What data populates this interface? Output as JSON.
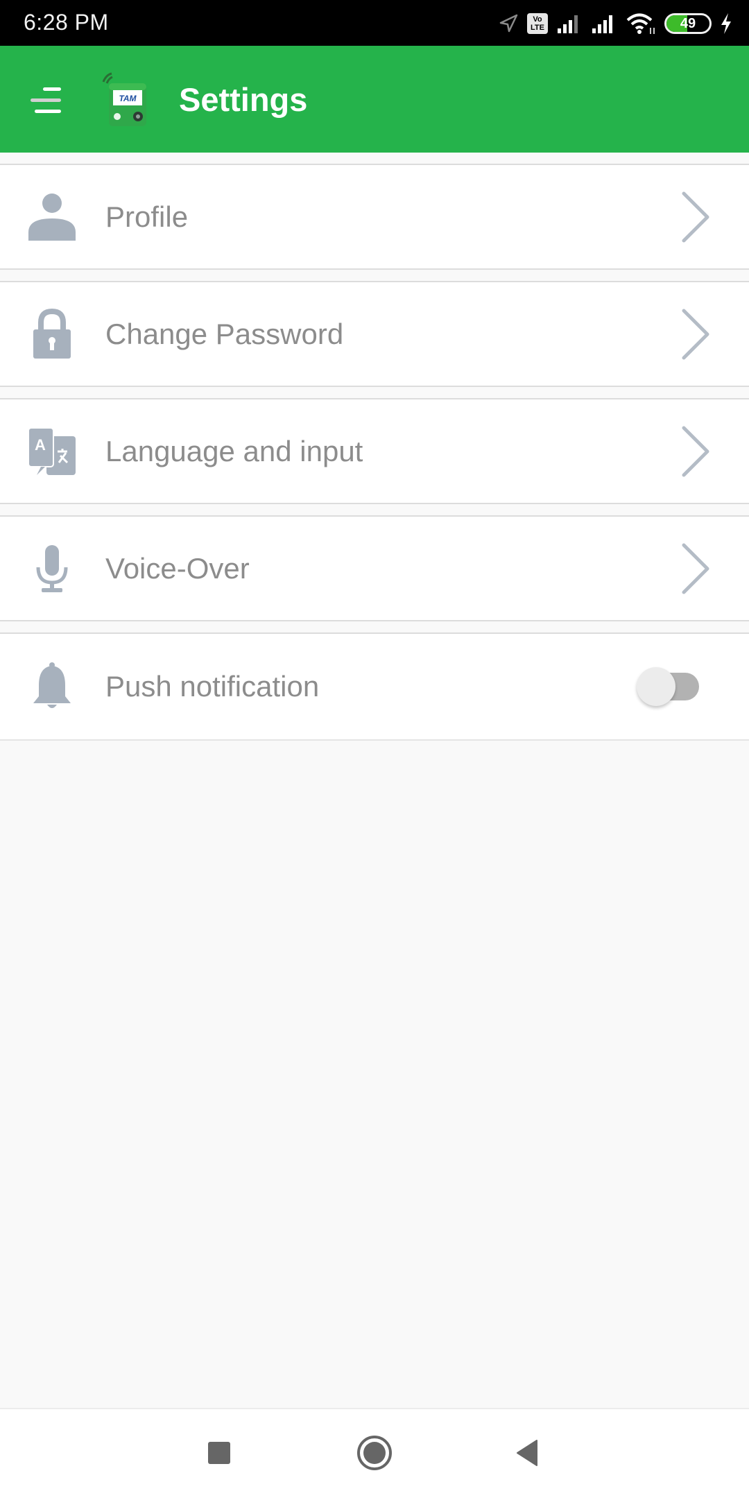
{
  "status_bar": {
    "time": "6:28 PM",
    "icons": [
      "location-arrow-icon",
      "volte-icon",
      "signal-sim1-icon",
      "signal-sim2-icon",
      "wifi-icon",
      "battery-icon",
      "charging-bolt-icon"
    ],
    "volte_line1": "Vo",
    "volte_line2": "LTE",
    "battery_percent": 49,
    "battery_text": "49",
    "battery_color": "#3dbb2a",
    "charging": true
  },
  "app_bar": {
    "title": "Settings",
    "menu_icon": "hamburger-menu-icon",
    "logo_icon": "tam-bus-logo-icon",
    "logo_text": "TAM",
    "background_color": "#25b34b"
  },
  "settings": {
    "items": [
      {
        "label": "Profile",
        "icon": "person-icon",
        "trailing": "chevron-right-icon"
      },
      {
        "label": "Change Password",
        "icon": "lock-icon",
        "trailing": "chevron-right-icon"
      },
      {
        "label": "Language and input",
        "icon": "translate-icon",
        "trailing": "chevron-right-icon"
      },
      {
        "label": "Voice-Over",
        "icon": "microphone-icon",
        "trailing": "chevron-right-icon"
      },
      {
        "label": "Push notification",
        "icon": "bell-icon",
        "trailing": "toggle",
        "toggle_on": false
      }
    ],
    "icon_color": "#a7b1bd",
    "label_color": "#8c8c8c"
  },
  "nav_bar": {
    "buttons": [
      {
        "name": "recents",
        "icon": "recents-square-icon"
      },
      {
        "name": "home",
        "icon": "home-circle-icon"
      },
      {
        "name": "back",
        "icon": "back-triangle-icon"
      }
    ]
  }
}
